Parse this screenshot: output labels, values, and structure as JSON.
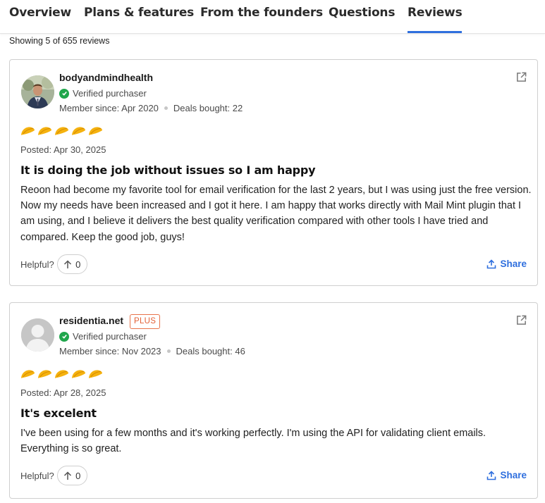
{
  "tabs": [
    {
      "label": "Overview"
    },
    {
      "label": "Plans & features"
    },
    {
      "label": "From the founders"
    },
    {
      "label": "Questions"
    },
    {
      "label": "Reviews",
      "active": true
    }
  ],
  "review_count_text": "Showing 5 of 655 reviews",
  "colors": {
    "accent": "#2f6fde",
    "verified": "#1fa64b",
    "plus": "#e25f35",
    "star": "#f5b20f"
  },
  "reviews": [
    {
      "username": "bodyandmindhealth",
      "badge": "",
      "verified": "Verified purchaser",
      "member_since": "Member since: Apr 2020",
      "deals": "Deals bought: 22",
      "rating": 5,
      "posted": "Posted: Apr 30, 2025",
      "title": "It is doing the job without issues so I am happy",
      "body": "Reoon had become my favorite tool for email verification for the last 2 years, but I was using just the free version. Now my needs have been increased and I got it here. I am happy that works directly with Mail Mint plugin that I am using, and I believe it delivers the best quality verification compared with other tools I have tried and compared. Keep the good job, guys!",
      "helpful_label": "Helpful?",
      "helpful_count": "0",
      "share_label": "Share"
    },
    {
      "username": "residentia.net",
      "badge": "PLUS",
      "verified": "Verified purchaser",
      "member_since": "Member since: Nov 2023",
      "deals": "Deals bought: 46",
      "rating": 5,
      "posted": "Posted: Apr 28, 2025",
      "title": "It's excelent",
      "body": "I've been using for a few months and it's working perfectly. I'm using the API for validating client emails. Everything is so great.",
      "helpful_label": "Helpful?",
      "helpful_count": "0",
      "share_label": "Share"
    }
  ]
}
